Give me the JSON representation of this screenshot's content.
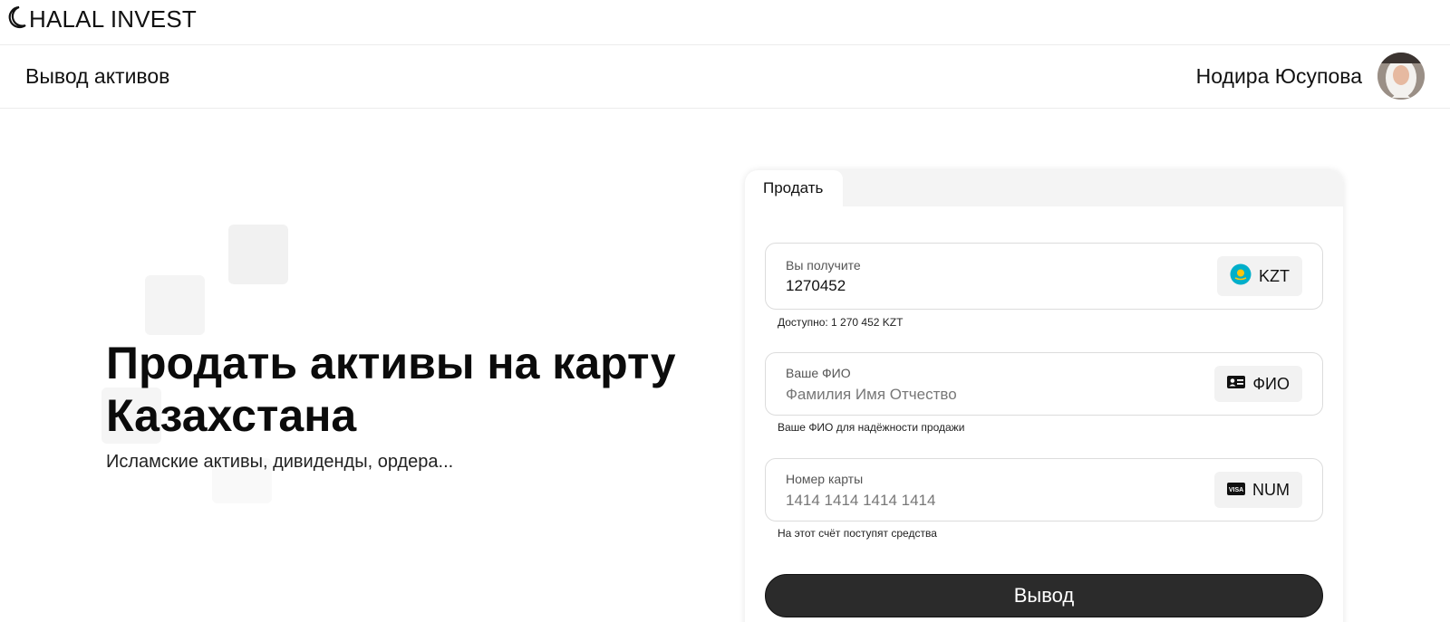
{
  "brand": {
    "name": "HALAL INVEST",
    "icon": "crescent-moon-icon"
  },
  "header": {
    "title": "Вывод активов",
    "user_name": "Нодира Юсупова"
  },
  "hero": {
    "title": "Продать активы на карту Казахстана",
    "subtitle": "Исламские активы, дивиденды, ордера..."
  },
  "form": {
    "tab": "Продать",
    "amount": {
      "label": "Вы получите",
      "value": "1270452",
      "currency": "KZT",
      "currency_icon": "kazakhstan-flag-icon",
      "hint": "Доступно: 1 270 452 KZT"
    },
    "name": {
      "label": "Ваше ФИО",
      "placeholder": "Фамилия Имя Отчество",
      "badge": "ФИО",
      "badge_icon": "id-card-icon",
      "hint": "Ваше ФИО для надёжности продажи"
    },
    "card": {
      "label": "Номер карты",
      "placeholder": "1414 1414 1414 1414",
      "badge": "NUM",
      "badge_icon": "visa-card-icon",
      "hint": "На этот счёт поступят средства"
    },
    "submit_label": "Вывод"
  },
  "colors": {
    "button": "#2b2b2b",
    "field_border": "#dcdcdc",
    "badge_bg": "#f2f2f2",
    "flag_blue": "#00afca",
    "flag_gold": "#fec50c"
  }
}
